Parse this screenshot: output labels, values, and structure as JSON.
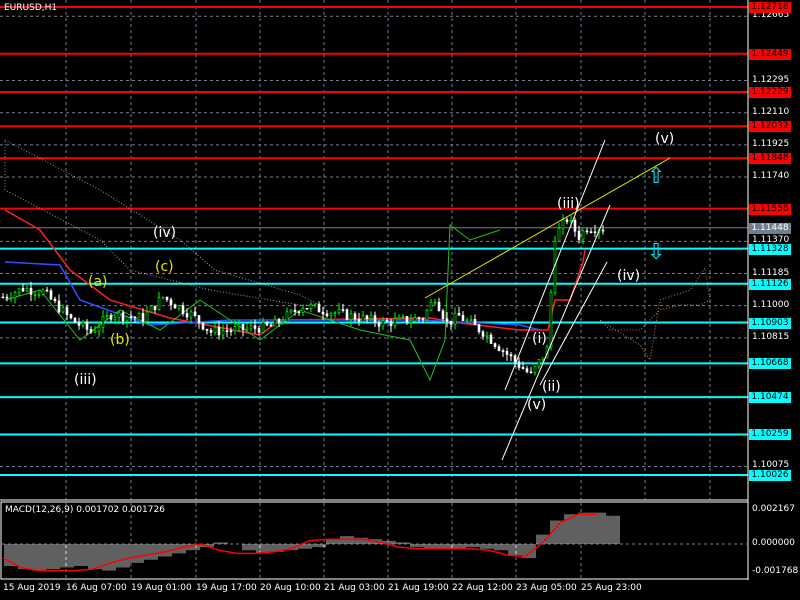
{
  "window": {
    "title": "EURUSD,H1"
  },
  "colors": {
    "resistance": "#ff0000",
    "support": "#00ffff",
    "current": "#708090",
    "bull": "#00ff00",
    "grid": "#708090"
  },
  "chart_data": {
    "type": "candlestick",
    "symbol": "EURUSD",
    "timeframe": "H1",
    "ylim": [
      1.0995,
      1.1275
    ],
    "y_ticks": [
      "1.12665",
      "1.12295",
      "1.12110",
      "1.11925",
      "1.11740",
      "1.11370",
      "1.11185",
      "1.11000",
      "1.10815",
      "1.10075"
    ],
    "x_ticks": [
      "15 Aug 2019",
      "16 Aug 07:00",
      "19 Aug 01:00",
      "19 Aug 17:00",
      "20 Aug 10:00",
      "21 Aug 03:00",
      "21 Aug 19:00",
      "22 Aug 12:00",
      "23 Aug 05:00",
      "25 Aug 23:00"
    ],
    "resistance_levels": [
      "1.12718",
      "1.12449",
      "1.12229",
      "1.12032",
      "1.11848",
      "1.11558"
    ],
    "support_levels": [
      "1.11328",
      "1.11126",
      "1.10903",
      "1.10668",
      "1.10474",
      "1.10259",
      "1.10026"
    ],
    "current_price": "1.11448",
    "price_path": [
      [
        0,
        1.1105
      ],
      [
        5,
        1.111
      ],
      [
        10,
        1.1108
      ],
      [
        17,
        1.1092
      ],
      [
        22,
        1.1085
      ],
      [
        27,
        1.1095
      ],
      [
        35,
        1.1093
      ],
      [
        40,
        1.1105
      ],
      [
        47,
        1.1095
      ],
      [
        52,
        1.1085
      ],
      [
        62,
        1.1087
      ],
      [
        67,
        1.1088
      ],
      [
        75,
        1.11
      ],
      [
        85,
        1.1095
      ],
      [
        95,
        1.109
      ],
      [
        105,
        1.1093
      ],
      [
        108,
        1.1105
      ],
      [
        111,
        1.109
      ],
      [
        114,
        1.1094
      ],
      [
        120,
        1.1085
      ],
      [
        127,
        1.107
      ],
      [
        132,
        1.106
      ],
      [
        136,
        1.1075
      ],
      [
        138,
        1.114
      ],
      [
        141,
        1.115
      ],
      [
        144,
        1.114
      ],
      [
        146,
        1.1145
      ],
      [
        150,
        1.1145
      ]
    ],
    "wave_labels": [
      "(iii)",
      "(a)",
      "(b)",
      "(c)",
      "(iv)",
      "(i)",
      "(ii)",
      "(iii)",
      "(iv)",
      "(v)",
      "(v)"
    ],
    "macd": {
      "label": "MACD(12,26,9) 0.001702 0.001726",
      "ylim": [
        -0.001768,
        0.002167
      ],
      "ticks": [
        "0.002167",
        "0.000000",
        "-0.001768"
      ],
      "histogram": [
        -0.0014,
        -0.0016,
        -0.0017,
        -0.0016,
        -0.0015,
        -0.0014,
        -0.0016,
        -0.0017,
        -0.0015,
        -0.0012,
        -0.001,
        -0.0008,
        -0.0006,
        -0.0004,
        -0.0002,
        0.0001,
        0.0,
        -0.0004,
        -0.0006,
        -0.0005,
        -0.0004,
        -0.0003,
        -0.0002,
        0.0003,
        0.0005,
        0.0004,
        0.0003,
        0.0002,
        0.0001,
        -0.0002,
        -0.0003,
        -0.0003,
        -0.0003,
        -0.0002,
        -0.0003,
        -0.0004,
        -0.0007,
        -0.0009,
        0.0006,
        0.0015,
        0.0019,
        0.002,
        0.002,
        0.0018
      ],
      "signal": [
        -0.0009,
        -0.0015,
        -0.0017,
        -0.0017,
        -0.0017,
        -0.0016,
        -0.0012,
        -0.0009,
        -0.0007,
        -0.0005,
        -0.0002,
        0.0,
        -0.0004,
        -0.0006,
        -0.0006,
        -0.0005,
        -0.0003,
        0.0002,
        0.0003,
        0.0003,
        0.0003,
        0.0001,
        -0.0002,
        -0.0003,
        -0.0003,
        -0.0003,
        -0.0003,
        -0.0004,
        -0.0007,
        -0.0008,
        0.0001,
        0.0014,
        0.0019,
        0.0019
      ]
    }
  }
}
